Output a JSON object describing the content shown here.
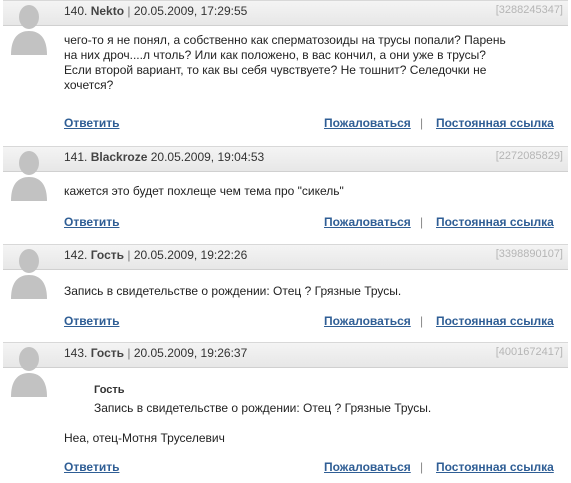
{
  "comments": [
    {
      "number": "140.",
      "author": "Nekto",
      "date": "20.05.2009, 17:29:55",
      "id": "[3288245347]",
      "lines": [
        "чего-то я не понял, а собственно как сперматозоиды на трусы попали? Парень",
        "на них дроч....л чтоль? Или как положено, в вас кончил, а они уже в трусы?",
        "Если второй вариант, то как вы себя чувствуете? Не тошнит? Селедочки не",
        "хочется?"
      ]
    },
    {
      "number": "141.",
      "author": "Blackroze",
      "date": "20.05.2009, 19:04:53",
      "id": "[2272085829]",
      "lines": [
        "кажется это будет похлеще чем тема про \"сикель\""
      ]
    },
    {
      "number": "142.",
      "author": "Гость",
      "date": "20.05.2009, 19:22:26",
      "id": "[3398890107]",
      "lines": [
        "Запись в свидетельстве о рождении: Отец ? Грязные Трусы."
      ]
    },
    {
      "number": "143.",
      "author": "Гость",
      "date": "20.05.2009, 19:26:37",
      "id": "[4001672417]",
      "quote": {
        "author": "Гость",
        "text": "Запись в свидетельстве о рождении: Отец ? Грязные Трусы."
      },
      "lines": [
        "Неа, отец-Мотня Труселевич"
      ]
    }
  ],
  "actions": {
    "reply": "Ответить",
    "report": "Пожаловаться",
    "separator": "|",
    "permalink": "Постоянная ссылка"
  },
  "meta_separator": "|"
}
